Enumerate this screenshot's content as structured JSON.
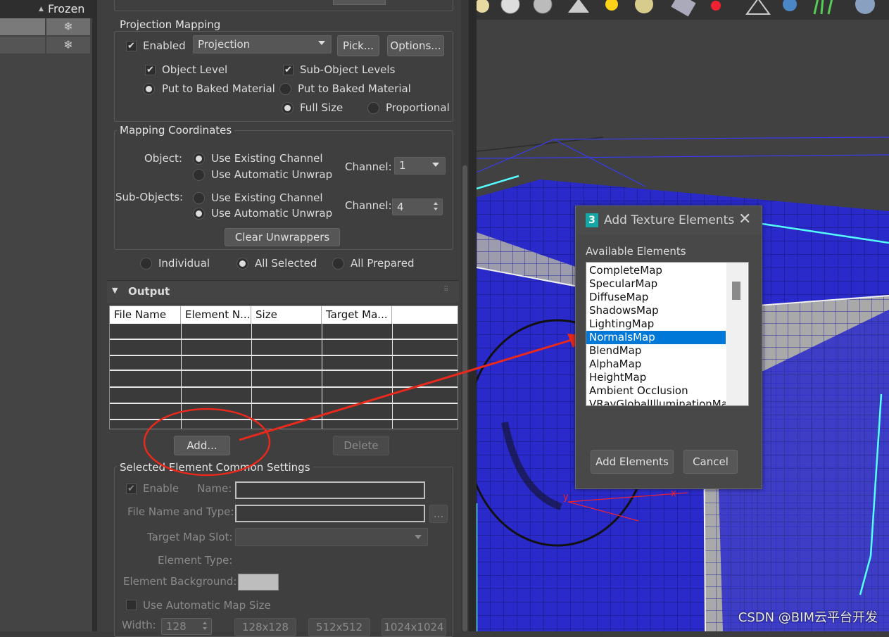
{
  "scene_explorer": {
    "column_header": "Frozen",
    "rows": [
      {
        "frozen_icon": "snowflake-icon",
        "selected": true
      },
      {
        "frozen_icon": "snowflake-icon",
        "selected": false
      }
    ]
  },
  "top_cut": {
    "label_left": "Enabled"
  },
  "projection_mapping": {
    "title": "Projection Mapping",
    "enabled_label": "Enabled",
    "enabled_checked": true,
    "projection_value": "Projection",
    "pick_label": "Pick...",
    "options_label": "Options...",
    "object_level_label": "Object Level",
    "sub_object_levels_label": "Sub-Object Levels",
    "put_baked_left_label": "Put to Baked Material",
    "put_baked_right_label": "Put to Baked Material",
    "full_size_label": "Full Size",
    "proportional_label": "Proportional"
  },
  "mapping_coordinates": {
    "title": "Mapping Coordinates",
    "object_label": "Object:",
    "sub_objects_label": "Sub-Objects:",
    "use_existing_label": "Use Existing Channel",
    "use_auto_label": "Use Automatic Unwrap",
    "channel_label": "Channel:",
    "object_channel": "1",
    "sub_channel": "4",
    "clear_label": "Clear Unwrappers"
  },
  "bake_scope": {
    "individual": "Individual",
    "all_selected": "All Selected",
    "all_prepared": "All Prepared"
  },
  "output": {
    "title": "Output",
    "columns": [
      "File Name",
      "Element N...",
      "Size",
      "Target Ma..."
    ],
    "add_label": "Add...",
    "delete_label": "Delete"
  },
  "selected_element": {
    "title": "Selected Element Common Settings",
    "enable_label": "Enable",
    "name_label": "Name:",
    "file_name_type_label": "File Name and Type:",
    "browse_label": "...",
    "target_map_slot_label": "Target Map Slot:",
    "element_type_label": "Element Type:",
    "element_background_label": "Element Background:",
    "auto_map_size_label": "Use Automatic Map Size",
    "width_label": "Width:",
    "width_value": "128",
    "preset1": "128x128",
    "preset2": "512x512",
    "preset3": "1024x1024"
  },
  "dialog": {
    "title": "Add Texture Elements",
    "app_badge": "3",
    "available_label": "Available Elements",
    "items": [
      "CompleteMap",
      "SpecularMap",
      "DiffuseMap",
      "ShadowsMap",
      "LightingMap",
      "NormalsMap",
      "BlendMap",
      "AlphaMap",
      "HeightMap",
      "Ambient Occlusion",
      "VRayGlobalIlluminationMap"
    ],
    "selected_item": "NormalsMap",
    "add_elements_label": "Add Elements",
    "cancel_label": "Cancel"
  },
  "viewport": {
    "axis_x": "x",
    "axis_y": "y",
    "watermark": "CSDN @BIM云平台开发"
  },
  "colors": {
    "accent_selection": "#0078d7",
    "annotation_red": "#e8291c",
    "mesh_blue": "#2222c8",
    "selection_cyan": "#5ff"
  }
}
